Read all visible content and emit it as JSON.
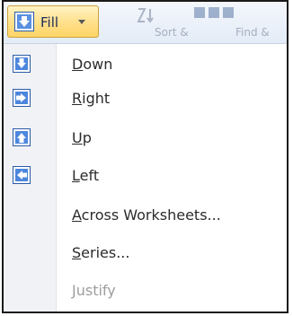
{
  "ribbon": {
    "fill_button": {
      "label": "Fill"
    },
    "ghost_text_1": "Sort &",
    "ghost_text_2": "Find &"
  },
  "menu": {
    "items": [
      {
        "label": "Down",
        "accel": "D",
        "rest": "own",
        "icon": "fill-down-icon",
        "enabled": true
      },
      {
        "label": "Right",
        "accel": "R",
        "rest": "ight",
        "icon": "fill-right-icon",
        "enabled": true
      },
      {
        "label": "Up",
        "accel": "U",
        "rest": "p",
        "icon": "fill-up-icon",
        "enabled": true
      },
      {
        "label": "Left",
        "accel": "L",
        "rest": "eft",
        "icon": "fill-left-icon",
        "enabled": true
      },
      {
        "label": "Across Worksheets...",
        "accel": "A",
        "rest": "cross Worksheets...",
        "icon": null,
        "enabled": true
      },
      {
        "label": "Series...",
        "accel": "S",
        "rest": "eries...",
        "icon": null,
        "enabled": true
      },
      {
        "label": "Justify",
        "accel": "J",
        "rest": "ustify",
        "icon": null,
        "enabled": false
      }
    ]
  },
  "colors": {
    "icon_blue": "#3d7ad6",
    "icon_frame": "#2b5aa8",
    "disabled_text": "#9d9d9d",
    "fill_button_bg": "#ffe18e"
  }
}
